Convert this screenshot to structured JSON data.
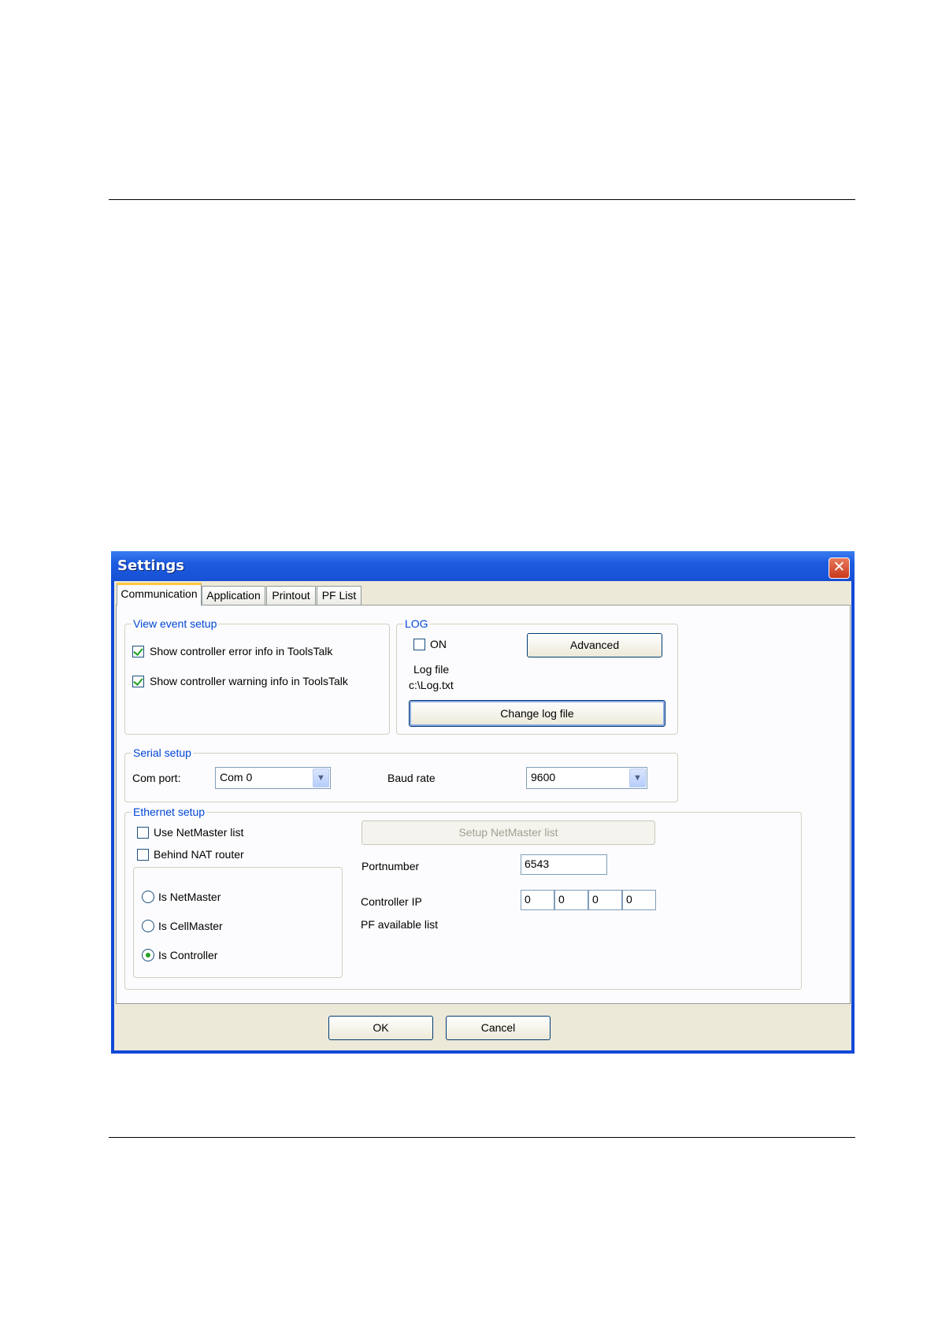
{
  "window": {
    "title": "Settings"
  },
  "tabs": [
    {
      "label": "Communication"
    },
    {
      "label": "Application"
    },
    {
      "label": "Printout"
    },
    {
      "label": "PF List"
    }
  ],
  "view_event": {
    "legend": "View event setup",
    "error_label": "Show controller error info in ToolsTalk",
    "error_checked": true,
    "warning_label": "Show controller warning info in ToolsTalk",
    "warning_checked": true
  },
  "log": {
    "legend": "LOG",
    "on_label": "ON",
    "on_checked": false,
    "advanced_label": "Advanced",
    "file_label": "Log file",
    "file_path": "c:\\Log.txt",
    "change_label": "Change log file"
  },
  "serial": {
    "legend": "Serial setup",
    "com_label": "Com port:",
    "com_value": "Com 0",
    "baud_label": "Baud rate",
    "baud_value": "9600"
  },
  "ethernet": {
    "legend": "Ethernet setup",
    "netmaster_list_label": "Use NetMaster list",
    "nat_label": "Behind NAT router",
    "setup_button_label": "Setup NetMaster list",
    "radios": [
      {
        "label": "Is NetMaster",
        "selected": false
      },
      {
        "label": "Is CellMaster",
        "selected": false
      },
      {
        "label": "Is Controller",
        "selected": true
      }
    ],
    "port_label": "Portnumber",
    "port_value": "6543",
    "ip_label": "Controller IP",
    "ip": [
      "0",
      "0",
      "0",
      "0"
    ],
    "pf_label": "PF available list"
  },
  "buttons": {
    "ok": "OK",
    "cancel": "Cancel"
  },
  "colors": {
    "title_bar": "#1d5be0",
    "legend_text": "#0046d5",
    "check_mark": "#21a121",
    "close_button": "#c9381c"
  }
}
